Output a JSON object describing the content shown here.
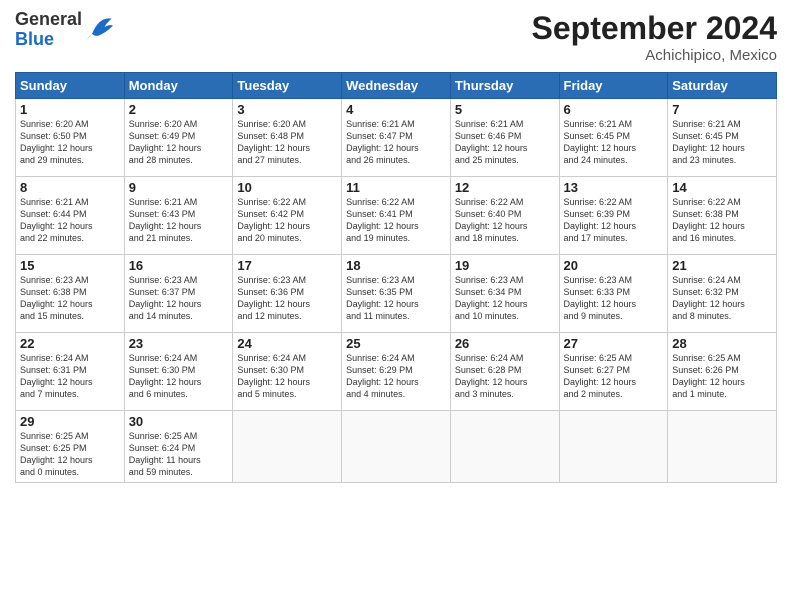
{
  "header": {
    "logo_general": "General",
    "logo_blue": "Blue",
    "month_title": "September 2024",
    "location": "Achichipico, Mexico"
  },
  "days_of_week": [
    "Sunday",
    "Monday",
    "Tuesday",
    "Wednesday",
    "Thursday",
    "Friday",
    "Saturday"
  ],
  "weeks": [
    [
      {
        "day": "1",
        "sunrise": "6:20 AM",
        "sunset": "6:50 PM",
        "daylight": "12 hours and 29 minutes."
      },
      {
        "day": "2",
        "sunrise": "6:20 AM",
        "sunset": "6:49 PM",
        "daylight": "12 hours and 28 minutes."
      },
      {
        "day": "3",
        "sunrise": "6:20 AM",
        "sunset": "6:48 PM",
        "daylight": "12 hours and 27 minutes."
      },
      {
        "day": "4",
        "sunrise": "6:21 AM",
        "sunset": "6:47 PM",
        "daylight": "12 hours and 26 minutes."
      },
      {
        "day": "5",
        "sunrise": "6:21 AM",
        "sunset": "6:46 PM",
        "daylight": "12 hours and 25 minutes."
      },
      {
        "day": "6",
        "sunrise": "6:21 AM",
        "sunset": "6:45 PM",
        "daylight": "12 hours and 24 minutes."
      },
      {
        "day": "7",
        "sunrise": "6:21 AM",
        "sunset": "6:45 PM",
        "daylight": "12 hours and 23 minutes."
      }
    ],
    [
      {
        "day": "8",
        "sunrise": "6:21 AM",
        "sunset": "6:44 PM",
        "daylight": "12 hours and 22 minutes."
      },
      {
        "day": "9",
        "sunrise": "6:21 AM",
        "sunset": "6:43 PM",
        "daylight": "12 hours and 21 minutes."
      },
      {
        "day": "10",
        "sunrise": "6:22 AM",
        "sunset": "6:42 PM",
        "daylight": "12 hours and 20 minutes."
      },
      {
        "day": "11",
        "sunrise": "6:22 AM",
        "sunset": "6:41 PM",
        "daylight": "12 hours and 19 minutes."
      },
      {
        "day": "12",
        "sunrise": "6:22 AM",
        "sunset": "6:40 PM",
        "daylight": "12 hours and 18 minutes."
      },
      {
        "day": "13",
        "sunrise": "6:22 AM",
        "sunset": "6:39 PM",
        "daylight": "12 hours and 17 minutes."
      },
      {
        "day": "14",
        "sunrise": "6:22 AM",
        "sunset": "6:38 PM",
        "daylight": "12 hours and 16 minutes."
      }
    ],
    [
      {
        "day": "15",
        "sunrise": "6:23 AM",
        "sunset": "6:38 PM",
        "daylight": "12 hours and 15 minutes."
      },
      {
        "day": "16",
        "sunrise": "6:23 AM",
        "sunset": "6:37 PM",
        "daylight": "12 hours and 14 minutes."
      },
      {
        "day": "17",
        "sunrise": "6:23 AM",
        "sunset": "6:36 PM",
        "daylight": "12 hours and 12 minutes."
      },
      {
        "day": "18",
        "sunrise": "6:23 AM",
        "sunset": "6:35 PM",
        "daylight": "12 hours and 11 minutes."
      },
      {
        "day": "19",
        "sunrise": "6:23 AM",
        "sunset": "6:34 PM",
        "daylight": "12 hours and 10 minutes."
      },
      {
        "day": "20",
        "sunrise": "6:23 AM",
        "sunset": "6:33 PM",
        "daylight": "12 hours and 9 minutes."
      },
      {
        "day": "21",
        "sunrise": "6:24 AM",
        "sunset": "6:32 PM",
        "daylight": "12 hours and 8 minutes."
      }
    ],
    [
      {
        "day": "22",
        "sunrise": "6:24 AM",
        "sunset": "6:31 PM",
        "daylight": "12 hours and 7 minutes."
      },
      {
        "day": "23",
        "sunrise": "6:24 AM",
        "sunset": "6:30 PM",
        "daylight": "12 hours and 6 minutes."
      },
      {
        "day": "24",
        "sunrise": "6:24 AM",
        "sunset": "6:30 PM",
        "daylight": "12 hours and 5 minutes."
      },
      {
        "day": "25",
        "sunrise": "6:24 AM",
        "sunset": "6:29 PM",
        "daylight": "12 hours and 4 minutes."
      },
      {
        "day": "26",
        "sunrise": "6:24 AM",
        "sunset": "6:28 PM",
        "daylight": "12 hours and 3 minutes."
      },
      {
        "day": "27",
        "sunrise": "6:25 AM",
        "sunset": "6:27 PM",
        "daylight": "12 hours and 2 minutes."
      },
      {
        "day": "28",
        "sunrise": "6:25 AM",
        "sunset": "6:26 PM",
        "daylight": "12 hours and 1 minute."
      }
    ],
    [
      {
        "day": "29",
        "sunrise": "6:25 AM",
        "sunset": "6:25 PM",
        "daylight": "12 hours and 0 minutes."
      },
      {
        "day": "30",
        "sunrise": "6:25 AM",
        "sunset": "6:24 PM",
        "daylight": "11 hours and 59 minutes."
      },
      null,
      null,
      null,
      null,
      null
    ]
  ]
}
